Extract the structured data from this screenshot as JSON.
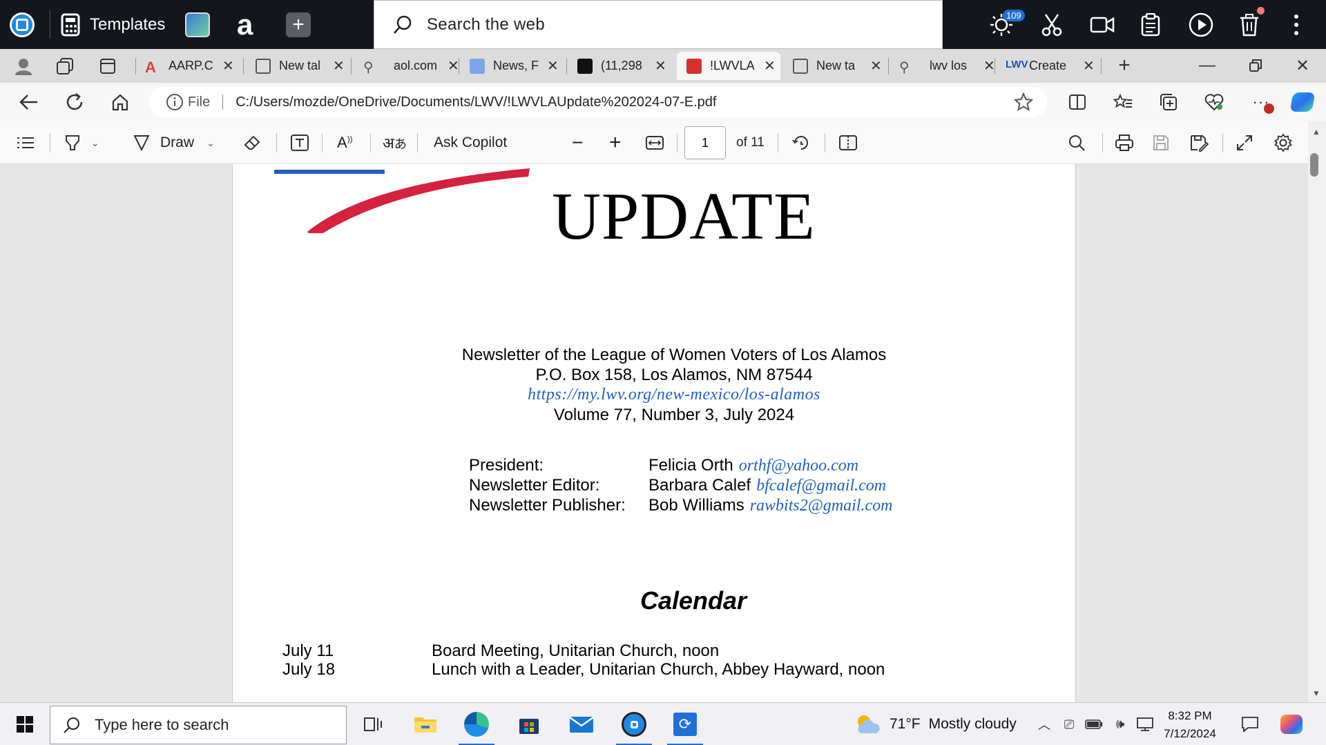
{
  "topbar": {
    "templates_label": "Templates",
    "search_placeholder": "Search the web",
    "notification_count": "109"
  },
  "tabs": [
    {
      "label": "AARP.C",
      "fav_color": "#e04040"
    },
    {
      "label": "New tal",
      "fav_color": "#555555"
    },
    {
      "label": "aol.com",
      "fav_color": "#555555"
    },
    {
      "label": "News, F",
      "fav_color": "#7aa7e6"
    },
    {
      "label": "(11,298",
      "fav_color": "#111111"
    },
    {
      "label": "!LWVLA",
      "fav_color": "#d9302c"
    },
    {
      "label": "New ta",
      "fav_color": "#555555"
    },
    {
      "label": "lwv los",
      "fav_color": "#555555"
    },
    {
      "label": "Create",
      "fav_color": "#1f4fbf"
    }
  ],
  "address": {
    "file_label": "File",
    "url": "C:/Users/mozde/OneDrive/Documents/LWV/!LWVLAUpdate%202024-07-E.pdf"
  },
  "pdf_toolbar": {
    "draw_label": "Draw",
    "copilot_label": "Ask Copilot",
    "page_number": "1",
    "page_total": "of 11"
  },
  "doc": {
    "title": "UPDATE",
    "lines": [
      "Newsletter of the League of Women Voters of Los Alamos",
      "P.O. Box 158, Los Alamos, NM   87544"
    ],
    "website": "https://my.lwv.org/new-mexico/los-alamos",
    "volume": "Volume 77, Number 3, July 2024",
    "staff": [
      {
        "role": "President:",
        "name": "Felicia Orth",
        "email": "orthf@yahoo.com"
      },
      {
        "role": "Newsletter Editor:",
        "name": "Barbara Calef",
        "email": "bfcalef@gmail.com"
      },
      {
        "role": "Newsletter Publisher:",
        "name": "Bob Williams",
        "email": "rawbits2@gmail.com"
      }
    ],
    "calendar_heading": "Calendar",
    "calendar": [
      {
        "date": "July 11",
        "event": "Board Meeting, Unitarian Church, noon"
      },
      {
        "date": "July 18",
        "event": "Lunch with a Leader, Unitarian Church, Abbey Hayward, noon"
      }
    ]
  },
  "taskbar": {
    "search_placeholder": "Type here to search",
    "weather_temp": "71°F",
    "weather_text": "Mostly cloudy",
    "time": "8:32 PM",
    "date": "7/12/2024"
  },
  "colors": {
    "link": "#1f5fbf",
    "logo_red": "#d4213d",
    "accent": "#1e6fd9"
  }
}
